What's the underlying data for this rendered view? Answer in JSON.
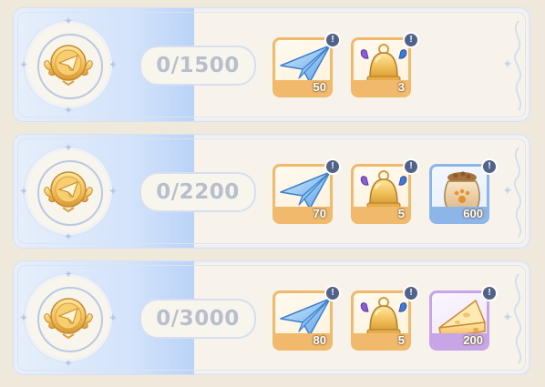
{
  "tiers": [
    {
      "progress": "0/1500",
      "rewards": [
        {
          "item": "paper-plane",
          "quantity": "50",
          "frame": "orange"
        },
        {
          "item": "golden-bell",
          "quantity": "3",
          "frame": "orange"
        }
      ]
    },
    {
      "progress": "0/2200",
      "rewards": [
        {
          "item": "paper-plane",
          "quantity": "70",
          "frame": "orange"
        },
        {
          "item": "golden-bell",
          "quantity": "5",
          "frame": "orange"
        },
        {
          "item": "pet-food-sack",
          "quantity": "600",
          "frame": "blue"
        }
      ]
    },
    {
      "progress": "0/3000",
      "rewards": [
        {
          "item": "paper-plane",
          "quantity": "80",
          "frame": "orange"
        },
        {
          "item": "golden-bell",
          "quantity": "5",
          "frame": "orange"
        },
        {
          "item": "cheese-wedge",
          "quantity": "200",
          "frame": "purple"
        }
      ]
    }
  ],
  "colors": {
    "background": "#efe9dc",
    "panel": "#f7f3ea",
    "accent_blue": "#b9d3f8",
    "frame_orange": "#f0b96b",
    "frame_blue": "#8db5e8",
    "frame_purple": "#c8a5e6",
    "progress_text": "#b7bfcc"
  }
}
